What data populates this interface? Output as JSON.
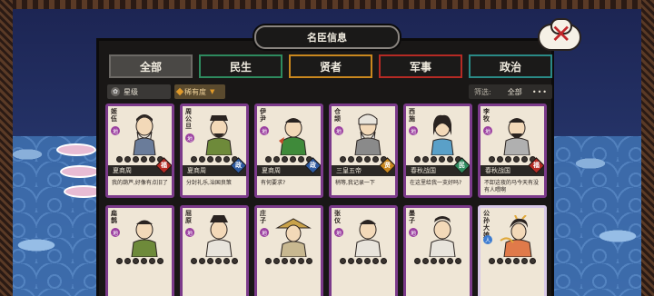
{
  "window": {
    "title": "名臣信息"
  },
  "tabs": [
    {
      "label": "全部"
    },
    {
      "label": "民生"
    },
    {
      "label": "贤者"
    },
    {
      "label": "军事"
    },
    {
      "label": "政治"
    }
  ],
  "filters": {
    "rank_label": "星级",
    "rarity_label": "稀有度",
    "screen_label": "筛选:",
    "screen_value": "全部",
    "more": "•••"
  },
  "cards_row1": [
    {
      "name": "姬伍",
      "grade": "地",
      "stars_on": 0,
      "faction": "夏商周",
      "type": "福",
      "type_color": "#b52a24",
      "quote": "我的葫芦,好像有点旧了"
    },
    {
      "name": "周公旦",
      "grade": "地",
      "stars_on": 0,
      "faction": "夏商周",
      "type": "政",
      "type_color": "#2e5aa0",
      "quote": "分封礼乐,治国良策"
    },
    {
      "name": "伊尹",
      "grade": "地",
      "stars_on": 0,
      "faction": "夏商周",
      "type": "政",
      "type_color": "#2e5aa0",
      "quote": "有何要求?"
    },
    {
      "name": "仓颉",
      "grade": "地",
      "stars_on": 0,
      "faction": "三皇五帝",
      "type": "贤",
      "type_color": "#c9871e",
      "quote": "稍等,我记录一下"
    },
    {
      "name": "西施",
      "grade": "地",
      "stars_on": 0,
      "faction": "春秋战国",
      "type": "民",
      "type_color": "#2e8a5e",
      "quote": "在这里给我一支好吗?"
    },
    {
      "name": "李牧",
      "grade": "地",
      "stars_on": 0,
      "faction": "春秋战国",
      "type": "福",
      "type_color": "#b52a24",
      "quote": "不卸这夜的马今天有没有人喂啊"
    }
  ],
  "cards_row2": [
    {
      "name": "扁鹊",
      "grade": "地"
    },
    {
      "name": "屈原",
      "grade": "地"
    },
    {
      "name": "庄子",
      "grade": "地"
    },
    {
      "name": "张仪",
      "grade": "地"
    },
    {
      "name": "墨子",
      "grade": "地"
    },
    {
      "name": "公孙大娘",
      "grade": "人"
    }
  ]
}
